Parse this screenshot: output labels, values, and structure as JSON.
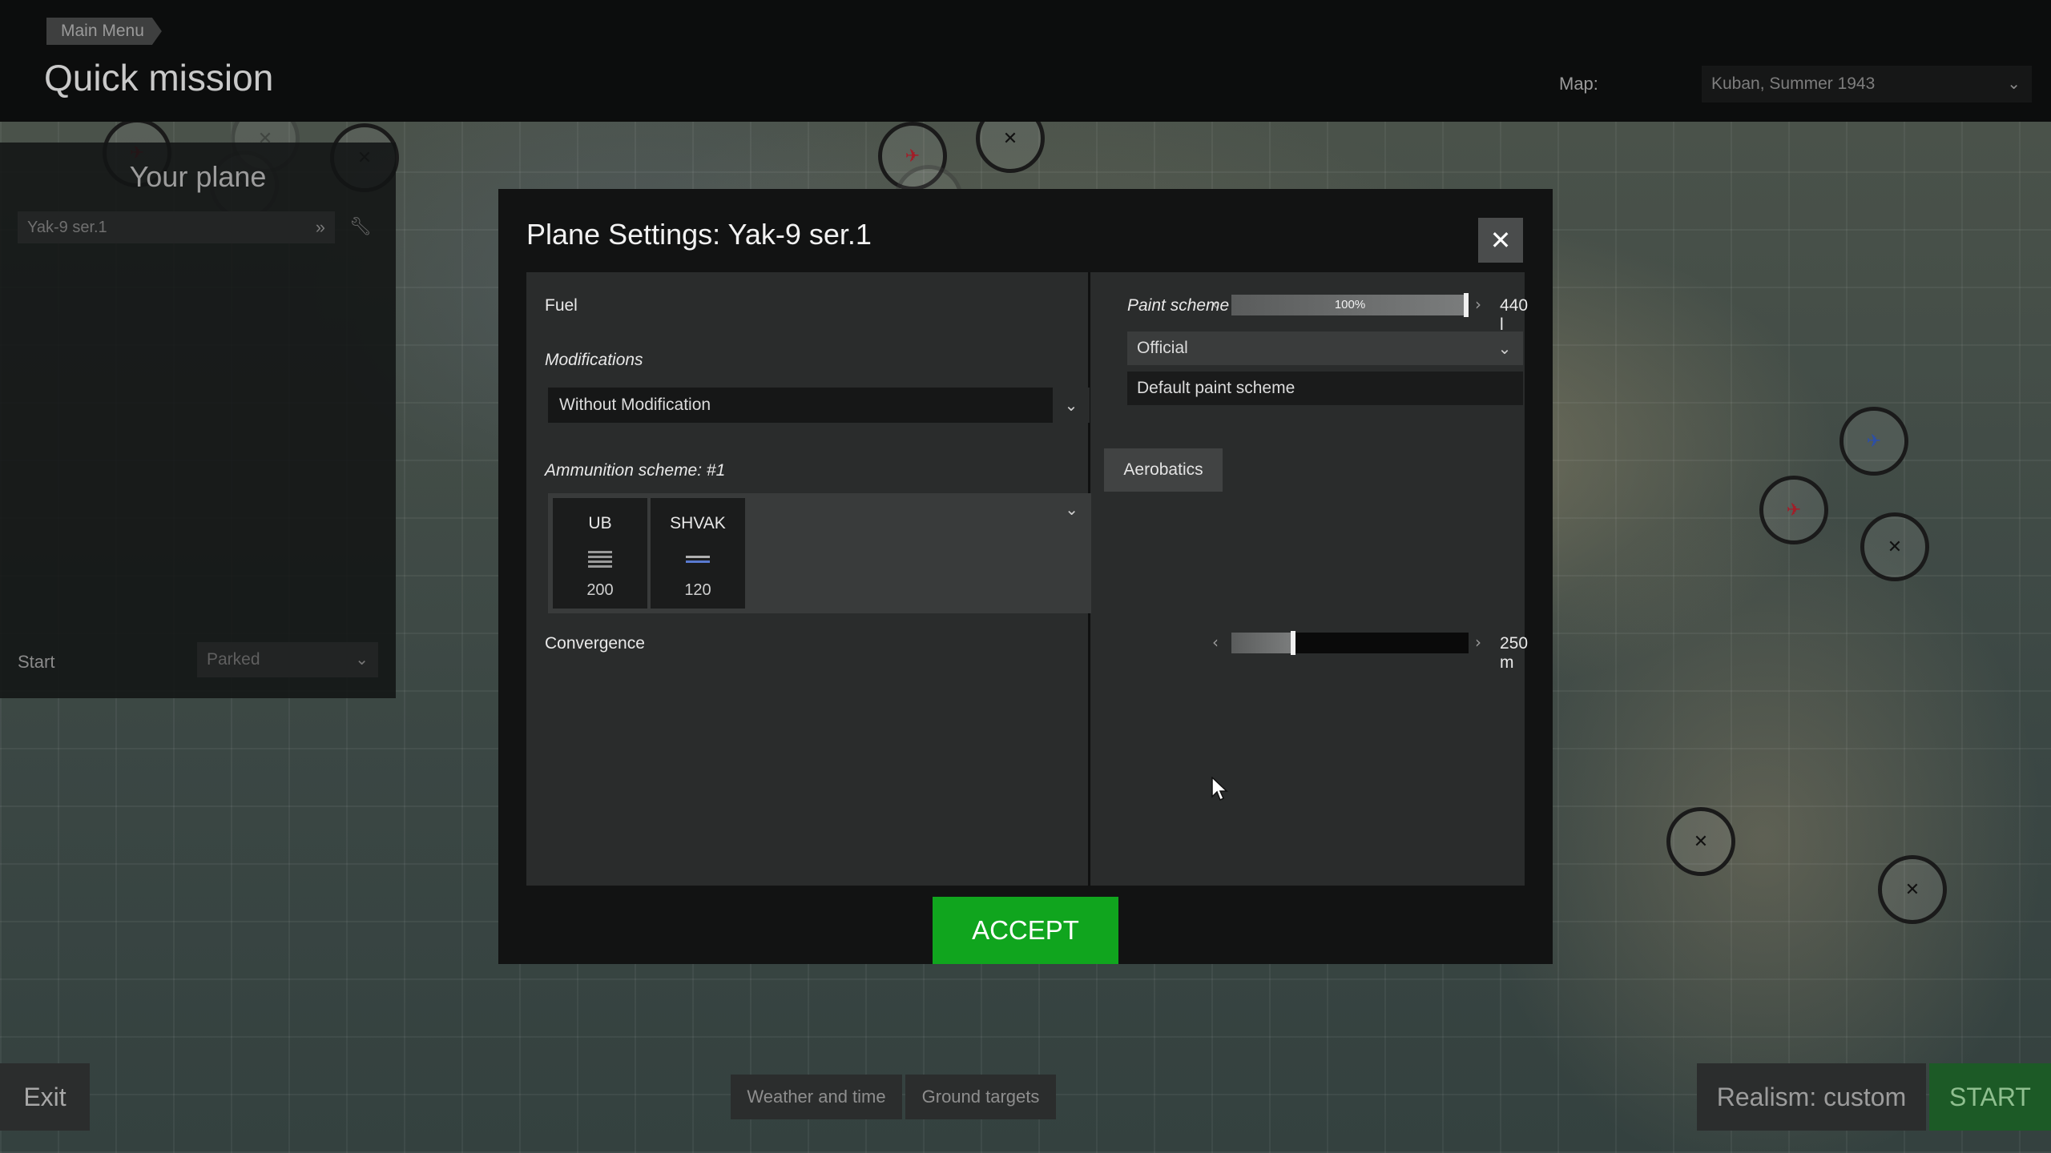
{
  "topbar": {
    "breadcrumb": "Main Menu",
    "title": "Quick mission",
    "map_label": "Map:",
    "map_value": "Kuban, Summer 1943"
  },
  "left_panel": {
    "title": "Your plane",
    "plane": "Yak-9 ser.1",
    "start_label": "Start",
    "start_value": "Parked"
  },
  "bottom": {
    "exit": "Exit",
    "tabs": [
      "Weather and time",
      "Ground targets"
    ],
    "realism": "Realism: custom",
    "start": "START"
  },
  "modal": {
    "title": "Plane Settings: Yak-9 ser.1",
    "close": "✕",
    "fuel": {
      "label": "Fuel",
      "percent_text": "100%",
      "percent": 100,
      "amount": "440 l"
    },
    "modifications": {
      "label": "Modifications",
      "value": "Without Modification"
    },
    "ammo": {
      "label": "Ammunition scheme: #1",
      "preset_button": "Aerobatics",
      "weapons": [
        {
          "name": "UB",
          "count": "200"
        },
        {
          "name": "SHVAK",
          "count": "120"
        }
      ]
    },
    "convergence": {
      "label": "Convergence",
      "value": "250 m",
      "fraction": 0.25
    },
    "paint": {
      "label": "Paint scheme",
      "value": "Official",
      "option": "Default paint scheme"
    },
    "accept": "ACCEPT"
  },
  "colors": {
    "accept": "#10a51e",
    "start": "#1c5a26"
  }
}
